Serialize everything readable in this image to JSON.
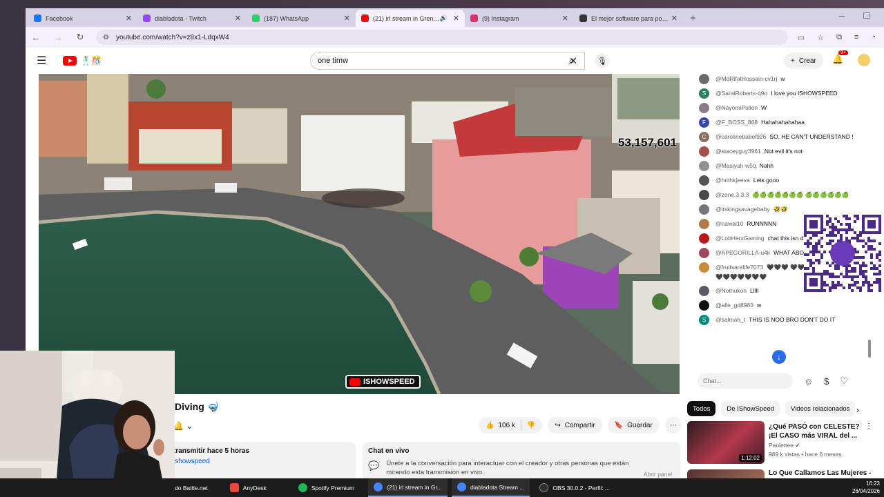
{
  "browser": {
    "tabs": [
      {
        "title": "Facebook",
        "favicon_color": "#1877f2",
        "active": false
      },
      {
        "title": "diabladota - Twitch",
        "favicon_color": "#9146ff",
        "active": false
      },
      {
        "title": "(187) WhatsApp",
        "favicon_color": "#25d366",
        "active": false
      },
      {
        "title": "(21) irl stream in Grenada",
        "favicon_color": "#ff0000",
        "active": true
      },
      {
        "title": "(9) Instagram",
        "favicon_color": "#e1306c",
        "active": false
      },
      {
        "title": "El mejor software para potencia",
        "favicon_color": "#333333",
        "active": false
      }
    ],
    "url": "youtube.com/watch?v=z8x1-LdqxW4"
  },
  "youtube": {
    "search_value": "one timw",
    "create_label": "Crear",
    "notif_badge": "9+"
  },
  "video": {
    "counter": "53,157,601",
    "watermark": "ISHOWSPEED",
    "title": "Diving 🤿",
    "likes": "106 k",
    "share_label": "Compartir",
    "save_label": "Guardar"
  },
  "description": {
    "line1": "transmitir hace 5 horas",
    "line2": "ishowspeed"
  },
  "chat_panel": {
    "heading": "Chat en vivo",
    "body": "Únete a la conversación para interactuar con el creador y otras personas que están mirando esta transmisión en vivo.",
    "open_button": "Abrir panel"
  },
  "live_chat": {
    "messages": [
      {
        "author": "@MdRifatHossain-cv1rj",
        "text": "w",
        "av_color": "#6b6b6b",
        "initial": ""
      },
      {
        "author": "@SaraiRoberts-q9o",
        "text": "I love you ISHOWSPEED",
        "av_color": "#2e7d62",
        "initial": "S"
      },
      {
        "author": "@NayomiPullen",
        "text": "W",
        "av_color": "#8a7a8a",
        "initial": ""
      },
      {
        "author": "@F_BOSS_868",
        "text": "Hahahahahahaa",
        "av_color": "#3949ab",
        "initial": "F"
      },
      {
        "author": "@carolinebabel926",
        "text": "SO, HE CAN'T UNDERSTAND !",
        "av_color": "#8d6e63",
        "initial": "C"
      },
      {
        "author": "@staceyguy3961",
        "text": "Not evil it's not",
        "av_color": "#a0524a",
        "initial": ""
      },
      {
        "author": "@Masiyah-w5q",
        "text": "Nahh",
        "av_color": "#909090",
        "initial": ""
      },
      {
        "author": "@hrithkjeeva",
        "text": "Lets gooo",
        "av_color": "#555555",
        "initial": ""
      },
      {
        "author": "@zone.3.3.3",
        "text": "🍏🍏🍏🍏🍏🍏🍏 🍏🍏🍏🍏🍏🍏",
        "av_color": "#4a4a4a",
        "initial": ""
      },
      {
        "author": "@itskingsavagebaby",
        "text": "🤣🤣",
        "av_color": "#777777",
        "initial": ""
      },
      {
        "author": "@nawal10",
        "text": "RUNNNNN",
        "av_color": "#b07a4a",
        "initial": ""
      },
      {
        "author": "@LobHerxGaming",
        "text": "chat this isn devil",
        "av_color": "#b71c1c",
        "initial": ""
      },
      {
        "author": "@APEGORILLA-u4k",
        "text": "WHAT ABO",
        "av_color": "#9e4a5a",
        "initial": ""
      },
      {
        "author": "@fruitsarelife7073",
        "text": "🖤🖤🖤 🖤🖤🖤🖤🖤🖤🖤🖤🖤🖤 🖤🖤🖤🖤🖤🖤🖤🖤",
        "av_color": "#c98a3a",
        "initial": ""
      },
      {
        "author": "@Nothukon",
        "text": "Lllll",
        "av_color": "#5a5a6a",
        "initial": ""
      },
      {
        "author": "@alle_gd8983",
        "text": "w",
        "av_color": "#111111",
        "initial": ""
      },
      {
        "author": "@salmah_t",
        "text": "THIS IS NOO BRO DON'T DO IT",
        "av_color": "#00897b",
        "initial": "S"
      }
    ],
    "input_placeholder": "Chat..."
  },
  "chips": [
    "Todos",
    "De IShowSpeed",
    "Videos relacionados"
  ],
  "recommendations": [
    {
      "title": "¿Qué PASÓ con CELESTE? ¡El CASO más VIRAL del ...",
      "channel": "Paulettee",
      "views": "989 k vistas",
      "age": "hace 6 meses",
      "duration": "1:12:02"
    },
    {
      "title": "Lo Que Callamos Las Mujeres -"
    }
  ],
  "taskbar": {
    "items": [
      {
        "label": "do Battle.net",
        "color": "#148eff"
      },
      {
        "label": "AnyDesk",
        "color": "#ef443b"
      },
      {
        "label": "Spotify Premium",
        "color": "#1db954"
      },
      {
        "label": "(21) irl stream in Gr...",
        "color": "#4285f4"
      },
      {
        "label": "diabladota Stream ...",
        "color": "#4285f4"
      },
      {
        "label": "OBS 30.0.2 - Perfil: ...",
        "color": "#302e31"
      }
    ],
    "time": "16:23",
    "date": "26/04/2026"
  },
  "colors": {
    "accent": "#ff0000",
    "link": "#065fd4"
  }
}
